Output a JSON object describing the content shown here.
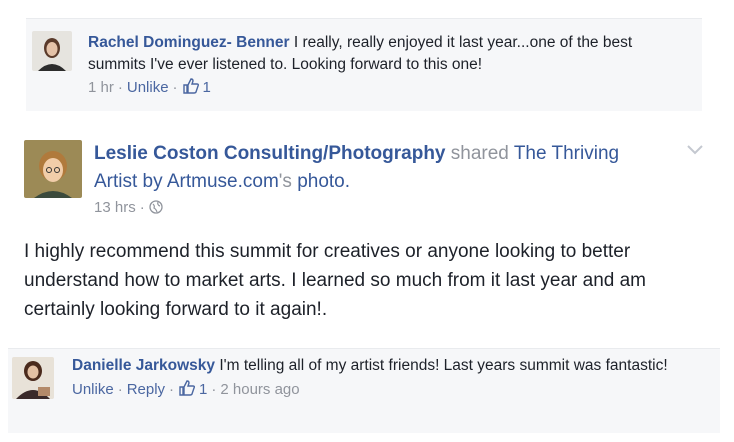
{
  "comment1": {
    "author": "Rachel Dominguez- Benner",
    "text": "I really, really enjoyed it last year...one of the best summits I've ever listened to. Looking forward to this one!",
    "time": "1 hr",
    "unlike_label": "Unlike",
    "like_count": "1"
  },
  "post": {
    "page_name": "Leslie Coston Consulting/Photography",
    "shared_word": "shared",
    "shared_page": "The Thriving Artist by Artmuse.com",
    "shared_suffix": "'s",
    "shared_object": "photo.",
    "time": "13 hrs",
    "privacy_icon": "globe-icon",
    "text": "I highly recommend this summit for creatives or anyone looking to better understand how to market arts. I learned so much from it last year and am certainly looking forward to it again!."
  },
  "comment2": {
    "author": "Danielle Jarkowsky",
    "text": "I'm telling all of my artist friends! Last years summit was fantastic!",
    "unlike_label": "Unlike",
    "reply_label": "Reply",
    "like_count": "1",
    "time": "2 hours ago"
  },
  "colors": {
    "link": "#365899",
    "meta": "#90949c",
    "comment_bg": "#f6f7f9"
  }
}
